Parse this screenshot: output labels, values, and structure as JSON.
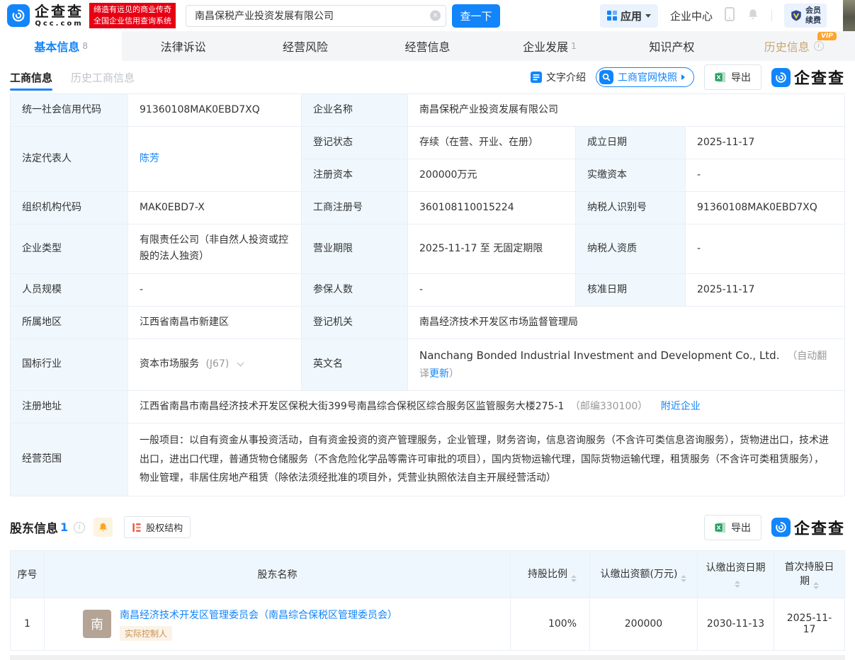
{
  "colors": {
    "brand_blue": "#1285fa",
    "banner_red": "#e60012",
    "vip_orange": "#ffa42d",
    "history_tab_tan": "#c9a76d",
    "label_cell_bg": "#f0f8fe",
    "table_border": "#e9eff5",
    "tag_bg": "#fbf3e8",
    "tag_text": "#c8914f",
    "avatar_bg": "#b3a496",
    "excel_green": "#1f9d5b",
    "equity_icon_red": "#f5503c",
    "bell_orange": "#ffa321"
  },
  "header": {
    "brand": "企查查",
    "domain": "Qcc.com",
    "slogan_line1": "缔造有远见的商业传奇",
    "slogan_line2": "全国企业信用查询系统",
    "search": {
      "value": "南昌保税产业投资发展有限公司",
      "button": "查一下"
    },
    "apps": "应用",
    "enterprise_center": "企业中心",
    "vip_line1": "会员",
    "vip_line2": "续费"
  },
  "nav": {
    "tabs": [
      {
        "label": "基本信息",
        "count": "8"
      },
      {
        "label": "法律诉讼"
      },
      {
        "label": "经营风险"
      },
      {
        "label": "经营信息"
      },
      {
        "label": "企业发展",
        "count": "1"
      },
      {
        "label": "知识产权"
      },
      {
        "label": "历史信息",
        "vip": "VIP"
      }
    ]
  },
  "toolbar": {
    "subtab_active": "工商信息",
    "subtab_history": "历史工商信息",
    "text_intro": "文字介绍",
    "snapshot": "工商官网快照",
    "export": "导出",
    "watermark": "企查查"
  },
  "info": {
    "credit_code_label": "统一社会信用代码",
    "credit_code": "91360108MAK0EBD7XQ",
    "company_name_label": "企业名称",
    "company_name": "南昌保税产业投资发展有限公司",
    "legal_rep_label": "法定代表人",
    "legal_rep": "陈芳",
    "status_label": "登记状态",
    "status": "存续（在营、开业、在册）",
    "established_label": "成立日期",
    "established": "2025-11-17",
    "reg_capital_label": "注册资本",
    "reg_capital": "200000万元",
    "paid_capital_label": "实缴资本",
    "paid_capital": "-",
    "org_code_label": "组织机构代码",
    "org_code": "MAK0EBD7-X",
    "reg_no_label": "工商注册号",
    "reg_no": "360108110015224",
    "taxpayer_id_label": "纳税人识别号",
    "taxpayer_id": "91360108MAK0EBD7XQ",
    "company_type_label": "企业类型",
    "company_type": "有限责任公司（非自然人投资或控股的法人独资）",
    "business_term_label": "营业期限",
    "business_term": "2025-11-17 至 无固定期限",
    "taxpayer_quality_label": "纳税人资质",
    "taxpayer_quality": "-",
    "staff_size_label": "人员规模",
    "staff_size": "-",
    "insured_label": "参保人数",
    "insured": "-",
    "approval_date_label": "核准日期",
    "approval_date": "2025-11-17",
    "region_label": "所属地区",
    "region": "江西省南昌市新建区",
    "registry_label": "登记机关",
    "registry": "南昌经济技术开发区市场监督管理局",
    "industry_label": "国标行业",
    "industry": "资本市场服务",
    "industry_code": "(J67)",
    "english_name_label": "英文名",
    "english_name": "Nanchang Bonded Industrial Investment and Development Co., Ltd.",
    "english_note_prefix": "（自动翻译",
    "english_note_update": "更新",
    "english_note_suffix": "）",
    "address_label": "注册地址",
    "address": "江西省南昌市南昌经济技术开发区保税大街399号南昌综合保税区综合服务区监管服务大楼275-1",
    "address_postcode": "（邮编330100）",
    "nearby": "附近企业",
    "scope_label": "经营范围",
    "scope": "一般项目：以自有资金从事投资活动，自有资金投资的资产管理服务，企业管理，财务咨询，信息咨询服务（不含许可类信息咨询服务），货物进出口，技术进出口，进出口代理，普通货物仓储服务（不含危险化学品等需许可审批的项目），国内货物运输代理，国际货物运输代理，租赁服务（不含许可类租赁服务），物业管理，非居住房地产租赁（除依法须经批准的项目外，凭营业执照依法自主开展经营活动）"
  },
  "shareholders": {
    "title": "股东信息",
    "count": "1",
    "equity_structure": "股权结构",
    "export": "导出",
    "watermark": "企查查",
    "columns": [
      "序号",
      "股东名称",
      "持股比例",
      "认缴出资额(万元)",
      "认缴出资日期",
      "首次持股日期"
    ],
    "rows": [
      {
        "index": "1",
        "avatar_char": "南",
        "name": "南昌经济技术开发区管理委员会（南昌综合保税区管理委员会）",
        "tag": "实际控制人",
        "ratio": "100%",
        "amount": "200000",
        "subscribe_date": "2030-11-13",
        "first_date": "2025-11-17"
      }
    ]
  }
}
